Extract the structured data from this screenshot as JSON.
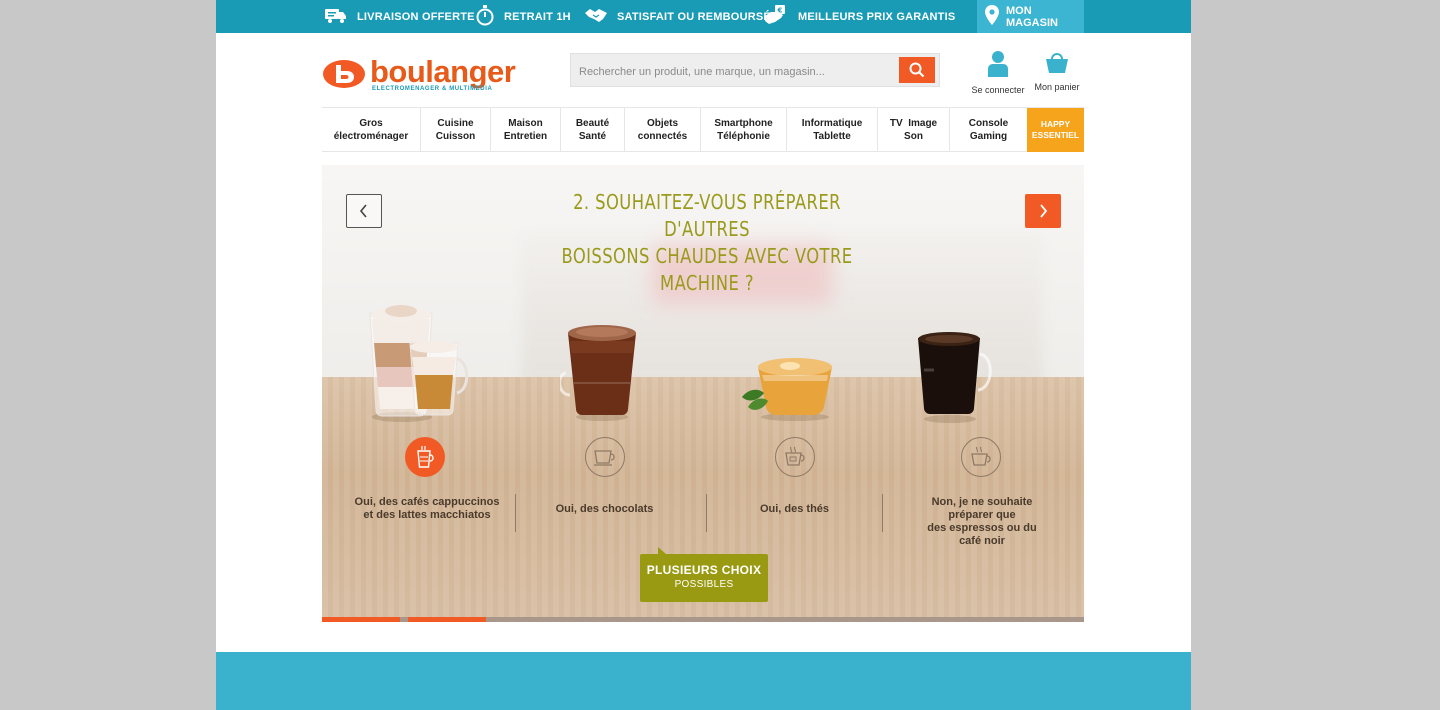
{
  "topbar": {
    "perks": [
      {
        "label": "LIVRAISON OFFERTE",
        "icon": "truck-icon"
      },
      {
        "label": "RETRAIT 1H",
        "icon": "stopwatch-icon"
      },
      {
        "label": "SATISFAIT OU REMBOURSÉ",
        "icon": "handshake-icon"
      },
      {
        "label": "MEILLEURS PRIX GARANTIS",
        "icon": "price-tag-icon"
      }
    ],
    "store_label": "MON MAGASIN"
  },
  "header": {
    "logo_word": "boulanger",
    "logo_sub": "ELECTROMENAGER & MULTIMEDIA",
    "search_placeholder": "Rechercher un produit, une marque, un magasin...",
    "account_label": "Se connecter",
    "cart_label": "Mon panier"
  },
  "nav": {
    "items": [
      {
        "line1": "Gros",
        "line2": "électroménager"
      },
      {
        "line1": "Cuisine",
        "line2": "Cuisson"
      },
      {
        "line1": "Maison",
        "line2": "Entretien"
      },
      {
        "line1": "Beauté",
        "line2": "Santé"
      },
      {
        "line1": "Objets",
        "line2": "connectés"
      },
      {
        "line1": "Smartphone",
        "line2": "Téléphonie"
      },
      {
        "line1": "Informatique",
        "line2": "Tablette"
      },
      {
        "line1": "TV  Image",
        "line2": "Son"
      },
      {
        "line1": "Console",
        "line2": "Gaming"
      }
    ],
    "happy": {
      "line1": "HAPPY",
      "line2": "ESSENTIEL"
    }
  },
  "hero": {
    "question_line1": "2. SOUHAITEZ-VOUS PRÉPARER D'AUTRES",
    "question_line2": "BOISSONS CHAUDES AVEC VOTRE MACHINE ?",
    "options": [
      {
        "lines": [
          "Oui, des cafés cappuccinos",
          "et des lattes macchiatos"
        ],
        "selected": true,
        "icon": "latte-glass-icon"
      },
      {
        "lines": [
          "Oui, des chocolats"
        ],
        "selected": false,
        "icon": "chocolate-cup-icon"
      },
      {
        "lines": [
          "Oui, des thés"
        ],
        "selected": false,
        "icon": "tea-glass-icon"
      },
      {
        "lines": [
          "Non, je ne souhaite",
          "préparer que",
          "des espressos ou du",
          "café noir"
        ],
        "selected": false,
        "icon": "coffee-cup-icon"
      }
    ],
    "choix_line1": "PLUSIEURS CHOIX",
    "choix_line2": "POSSIBLES",
    "progress_steps_done": 2
  },
  "colors": {
    "brand_orange": "#f15a24",
    "topbar_blue": "#1a9bb5",
    "accent_yellow": "#f7a41d",
    "olive": "#9a9a12"
  }
}
